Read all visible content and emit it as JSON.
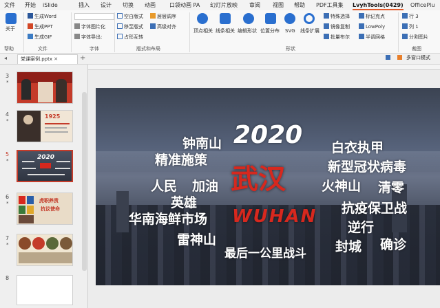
{
  "tabs": [
    "文件",
    "开始",
    "iSlide",
    "插入",
    "设计",
    "切换",
    "动画",
    "口袋动画 PA",
    "幻灯片放映",
    "审阅",
    "视图",
    "帮助",
    "PDF工具集",
    "LvyhTools(0429)",
    "OfficePlu"
  ],
  "ribbon": {
    "about": "关于",
    "help_group": "帮助",
    "file": {
      "items": [
        "生成Word",
        "生成PPT",
        "生成GIF"
      ],
      "label": "文件"
    },
    "font": {
      "items": [
        "字体图片化",
        "字体导出:"
      ],
      "label": "字体"
    },
    "layout": {
      "items": [
        "空白版式",
        "层层调序",
        "移至版式",
        "高级对齐",
        "占形互转"
      ],
      "label": "版式和布局"
    },
    "shape": {
      "items": [
        "顶点相关",
        "线条相关",
        "编辑形状",
        "位置分布",
        "SVG",
        "线条扩展"
      ],
      "extra": [
        "特殊选择",
        "标记克点",
        "镜像复制",
        "LowPoly",
        "批量布尔",
        "半调网格"
      ],
      "label": "形状"
    },
    "crop": {
      "items": [
        "行",
        "列",
        "分割图片"
      ],
      "row_val": "3",
      "col_val": "1",
      "label": "裁图"
    }
  },
  "toolbar": {
    "doc_tab": "党课案例.pptx",
    "add": "+",
    "right_label": "多窗口模式"
  },
  "slides": [
    {
      "num": "3",
      "star": "*"
    },
    {
      "num": "4",
      "star": "*"
    },
    {
      "num": "5",
      "star": "*"
    },
    {
      "num": "6",
      "star": "*"
    },
    {
      "num": "7",
      "star": "*"
    },
    {
      "num": "8",
      "star": ""
    }
  ],
  "thumb_texts": {
    "t4": "1925",
    "t5": "2020",
    "t6a": "虎职养责",
    "t6b": "抗议使命"
  },
  "slide": {
    "year": "2020",
    "wuhan_cn": "武汉",
    "wuhan_en": "WUHAN",
    "words": [
      "钟南山",
      "精准施策",
      "白衣执甲",
      "新型冠状病毒",
      "人民",
      "加油",
      "火神山",
      "清零",
      "英雄",
      "抗疫保卫战",
      "华南海鲜市场",
      "逆行",
      "雷神山",
      "封城",
      "确诊",
      "最后一公里战斗"
    ]
  },
  "colors": {
    "accent": "#e05a2b",
    "red": "#d7281e"
  }
}
